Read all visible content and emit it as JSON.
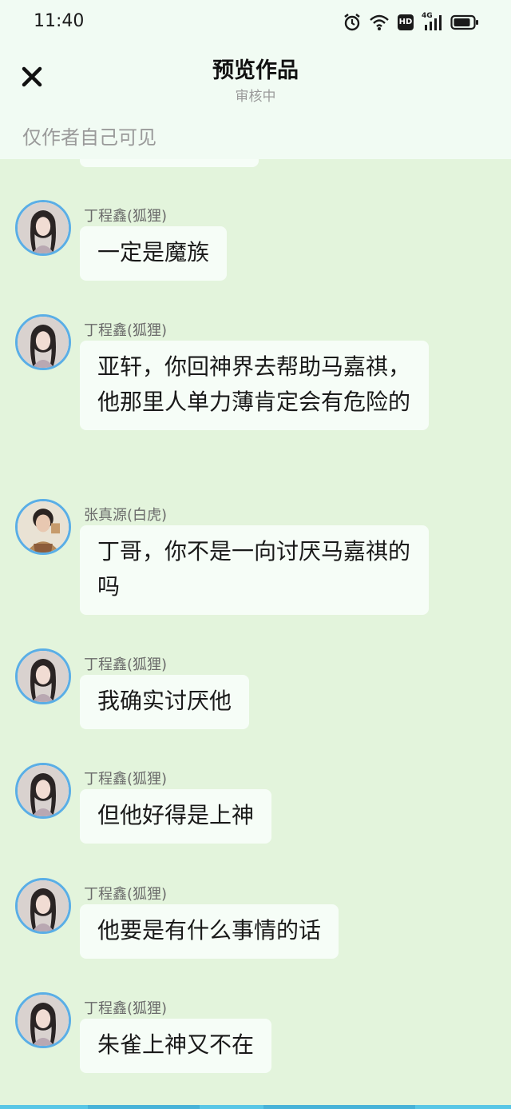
{
  "status_bar": {
    "time": "11:40",
    "icons": [
      "alarm-icon",
      "wifi-icon",
      "hd-icon",
      "signal-4g-icon",
      "battery-icon"
    ],
    "hd_label": "HD",
    "network_label": "4G"
  },
  "header": {
    "title": "预览作品",
    "subtitle": "审核中",
    "close_icon": "close-icon",
    "visibility_note": "仅作者自己可见"
  },
  "colors": {
    "header_bg": "#f1fbf3",
    "chat_bg": "#e3f4dc",
    "bubble_bg": "#f6fdf7",
    "avatar_ring": "#5aaee6",
    "bottom_strip": "#58c6e6"
  },
  "messages": [
    {
      "sender": "丁程鑫(狐狸)",
      "text": "一定是魔族",
      "avatar": "avatar-dingchengxin"
    },
    {
      "sender": "丁程鑫(狐狸)",
      "text": "亚轩，你回神界去帮助马嘉祺，他那里人单力薄肯定会有危险的",
      "avatar": "avatar-dingchengxin"
    },
    {
      "sender": "张真源(白虎)",
      "text": "丁哥，你不是一向讨厌马嘉祺的吗",
      "avatar": "avatar-zhangzhenyuan"
    },
    {
      "sender": "丁程鑫(狐狸)",
      "text": "我确实讨厌他",
      "avatar": "avatar-dingchengxin"
    },
    {
      "sender": "丁程鑫(狐狸)",
      "text": "但他好得是上神",
      "avatar": "avatar-dingchengxin"
    },
    {
      "sender": "丁程鑫(狐狸)",
      "text": "他要是有什么事情的话",
      "avatar": "avatar-dingchengxin"
    },
    {
      "sender": "丁程鑫(狐狸)",
      "text": "朱雀上神又不在",
      "avatar": "avatar-dingchengxin"
    }
  ]
}
